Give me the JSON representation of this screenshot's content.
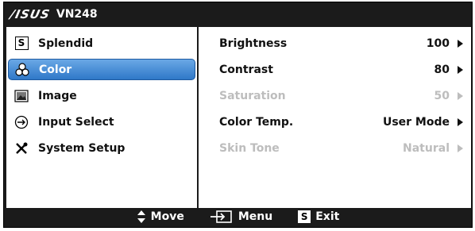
{
  "title": {
    "brand": "/ISUS",
    "model": "VN248"
  },
  "sidebar": {
    "items": [
      {
        "label": "Splendid",
        "icon": "splendid-s-icon"
      },
      {
        "label": "Color",
        "icon": "color-palette-icon",
        "active": true
      },
      {
        "label": "Image",
        "icon": "image-icon"
      },
      {
        "label": "Input Select",
        "icon": "input-arrow-icon"
      },
      {
        "label": "System Setup",
        "icon": "tools-icon"
      }
    ]
  },
  "settings": [
    {
      "label": "Brightness",
      "value": "100",
      "enabled": true
    },
    {
      "label": "Contrast",
      "value": "80",
      "enabled": true
    },
    {
      "label": "Saturation",
      "value": "50",
      "enabled": false
    },
    {
      "label": "Color Temp.",
      "value": "User Mode",
      "enabled": true
    },
    {
      "label": "Skin Tone",
      "value": "Natural",
      "enabled": false
    }
  ],
  "footer": {
    "move": "Move",
    "menu": "Menu",
    "exit": "Exit",
    "exit_key": "S"
  },
  "colors": {
    "frame": "#1b1b1b",
    "highlight": "#3a82d0",
    "disabled": "#bdbdbd"
  }
}
